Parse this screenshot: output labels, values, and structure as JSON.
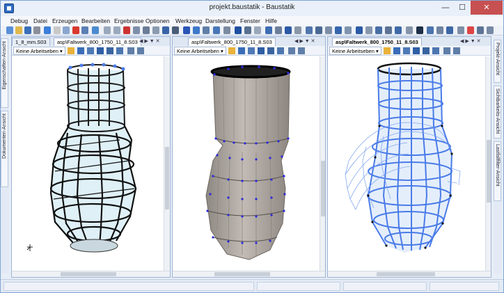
{
  "window": {
    "title": "projekt.baustatik - Baustatik",
    "controls": {
      "minimize": "—",
      "maximize": "☐",
      "close": "✕"
    }
  },
  "menu": [
    "Debug",
    "Datei",
    "Erzeugen",
    "Bearbeiten",
    "Ergebnisse",
    "Optionen",
    "Werkzeug",
    "Darstellung",
    "Fenster",
    "Hilfe"
  ],
  "left_sidebar": {
    "tabs": [
      "Eigenschaften-Ansicht",
      "Dokumenten-Ansicht"
    ]
  },
  "right_sidebar": {
    "tabs": [
      "Projekt-Ansicht",
      "Sichtbarkeits-Ansicht",
      "Lastfallfilter-Ansicht"
    ]
  },
  "panels": [
    {
      "tab_left": "1_8_mm.S03",
      "tab_active": "asp\\Faltwerk_800_1750_11_8.S03",
      "dropdown": "Keine Arbeitseben",
      "view_style": "wireframe"
    },
    {
      "tab_active": "asp\\Faltwerk_800_1750_11_8.S03",
      "dropdown": "Keine Arbeitseben",
      "view_style": "solid"
    },
    {
      "tab_active": "asp\\Faltwerk_800_1750_11_8.S03",
      "dropdown": "Keine Arbeitseben",
      "view_style": "blue-mesh"
    }
  ],
  "tab_nav": {
    "prev": "◀",
    "next": "▶",
    "pin": "▼",
    "close": "✕"
  },
  "icons": {
    "toolbar": [
      "new-icon",
      "open-icon",
      "save-icon",
      "print-icon",
      "pdf-icon",
      "undo-icon",
      "redo-icon",
      "cut-icon",
      "copy-icon",
      "paste-icon",
      "zoom-icon",
      "pan-icon",
      "rotate-icon",
      "settings-icon"
    ],
    "view_tools": [
      "select-arrow-icon",
      "zoom-window-icon",
      "zoom-in-icon",
      "pan-icon",
      "zoom-all-icon",
      "zoom-out-icon",
      "prev-view-icon",
      "next-view-icon"
    ]
  },
  "colors": {
    "accent": "#2f6cc4",
    "mesh_dark": "#1a1a1a",
    "mesh_blue": "#4a7be8",
    "node_blue": "#2a2ad8",
    "solid_surface": "#b3aca6",
    "glass": "#cfe6f2"
  }
}
